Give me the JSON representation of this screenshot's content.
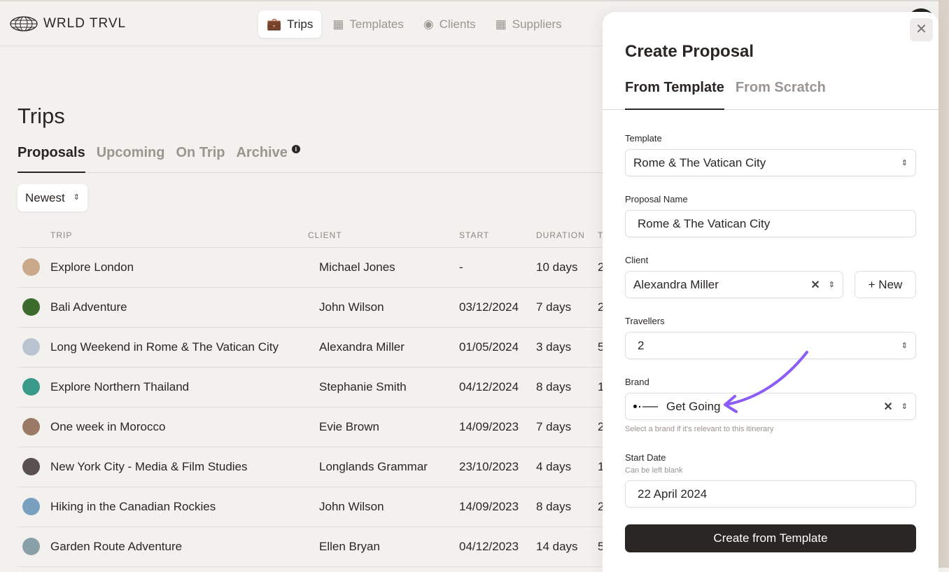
{
  "app": {
    "logo": "WRLD TRVL"
  },
  "nav": [
    {
      "label": "Trips",
      "icon": "suitcase-icon"
    },
    {
      "label": "Templates",
      "icon": "grid-icon"
    },
    {
      "label": "Clients",
      "icon": "users-icon"
    },
    {
      "label": "Suppliers",
      "icon": "building-icon"
    }
  ],
  "page": {
    "title": "Trips",
    "tabs": [
      "Proposals",
      "Upcoming",
      "On Trip",
      "Archive"
    ],
    "sort": "Newest"
  },
  "table": {
    "headers": [
      "TRIP",
      "CLIENT",
      "START",
      "DURATION",
      "T"
    ],
    "rows": [
      {
        "trip": "Explore London",
        "client": "Michael Jones",
        "start": "-",
        "duration": "10 days",
        "t": "2",
        "color": "#c9a98a"
      },
      {
        "trip": "Bali Adventure",
        "client": "John Wilson",
        "start": "03/12/2024",
        "duration": "7 days",
        "t": "2",
        "color": "#3d6b2e"
      },
      {
        "trip": "Long Weekend in Rome & The Vatican City",
        "client": "Alexandra Miller",
        "start": "01/05/2024",
        "duration": "3 days",
        "t": "5",
        "color": "#b9c4d0"
      },
      {
        "trip": "Explore Northern Thailand",
        "client": "Stephanie Smith",
        "start": "04/12/2024",
        "duration": "8 days",
        "t": "1",
        "color": "#3a9a8a"
      },
      {
        "trip": "One week in Morocco",
        "client": "Evie Brown",
        "start": "14/09/2023",
        "duration": "7 days",
        "t": "2",
        "color": "#9a7a66"
      },
      {
        "trip": "New York City - Media & Film Studies",
        "client": "Longlands Grammar",
        "start": "23/10/2023",
        "duration": "4 days",
        "t": "1",
        "color": "#5a5050"
      },
      {
        "trip": "Hiking in the Canadian Rockies",
        "client": "John Wilson",
        "start": "14/09/2023",
        "duration": "8 days",
        "t": "2",
        "color": "#7aa0c0"
      },
      {
        "trip": "Garden Route Adventure",
        "client": "Ellen Bryan",
        "start": "04/12/2023",
        "duration": "14 days",
        "t": "5",
        "color": "#8aa0a8"
      }
    ]
  },
  "panel": {
    "title": "Create Proposal",
    "tabs": [
      "From Template",
      "From Scratch"
    ],
    "template_label": "Template",
    "template_value": "Rome & The Vatican City",
    "name_label": "Proposal Name",
    "name_value": "Rome & The Vatican City",
    "client_label": "Client",
    "client_value": "Alexandra Miller",
    "new_label": "+ New",
    "travellers_label": "Travellers",
    "travellers_value": "2",
    "brand_label": "Brand",
    "brand_value": "Get Going",
    "brand_help": "Select a brand if it's relevant to this itinerary",
    "date_label": "Start Date",
    "date_sub": "Can be left blank",
    "date_value": "22 April 2024",
    "submit": "Create from Template",
    "accent": "#8b5cf6"
  }
}
